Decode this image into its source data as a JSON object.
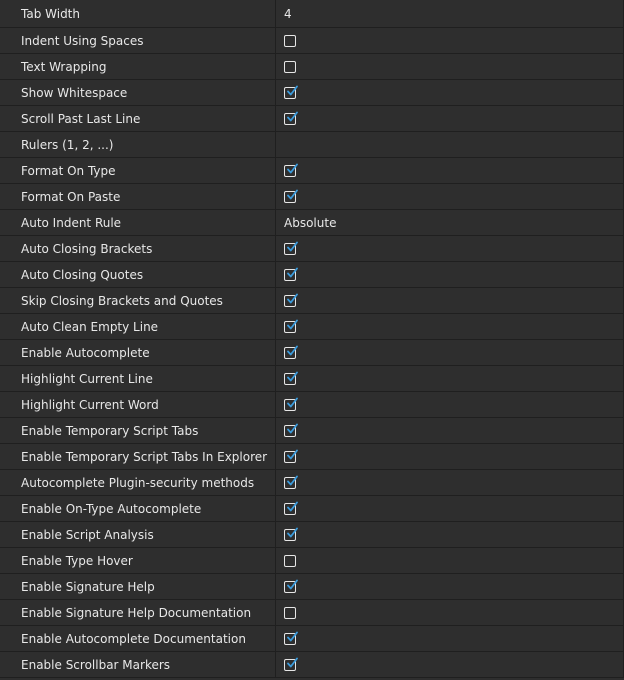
{
  "settings": {
    "rows": [
      {
        "label": "Tab Width",
        "type": "text",
        "value": "4"
      },
      {
        "label": "Indent Using Spaces",
        "type": "checkbox",
        "checked": false
      },
      {
        "label": "Text Wrapping",
        "type": "checkbox",
        "checked": false
      },
      {
        "label": "Show Whitespace",
        "type": "checkbox",
        "checked": true
      },
      {
        "label": "Scroll Past Last Line",
        "type": "checkbox",
        "checked": true
      },
      {
        "label": "Rulers (1, 2, ...)",
        "type": "text",
        "value": ""
      },
      {
        "label": "Format On Type",
        "type": "checkbox",
        "checked": true
      },
      {
        "label": "Format On Paste",
        "type": "checkbox",
        "checked": true
      },
      {
        "label": "Auto Indent Rule",
        "type": "text",
        "value": "Absolute"
      },
      {
        "label": "Auto Closing Brackets",
        "type": "checkbox",
        "checked": true
      },
      {
        "label": "Auto Closing Quotes",
        "type": "checkbox",
        "checked": true
      },
      {
        "label": "Skip Closing Brackets and Quotes",
        "type": "checkbox",
        "checked": true
      },
      {
        "label": "Auto Clean Empty Line",
        "type": "checkbox",
        "checked": true
      },
      {
        "label": "Enable Autocomplete",
        "type": "checkbox",
        "checked": true
      },
      {
        "label": "Highlight Current Line",
        "type": "checkbox",
        "checked": true
      },
      {
        "label": "Highlight Current Word",
        "type": "checkbox",
        "checked": true
      },
      {
        "label": "Enable Temporary Script Tabs",
        "type": "checkbox",
        "checked": true
      },
      {
        "label": "Enable Temporary Script Tabs In Explorer",
        "type": "checkbox",
        "checked": true
      },
      {
        "label": "Autocomplete Plugin-security methods",
        "type": "checkbox",
        "checked": true
      },
      {
        "label": "Enable On-Type Autocomplete",
        "type": "checkbox",
        "checked": true
      },
      {
        "label": "Enable Script Analysis",
        "type": "checkbox",
        "checked": true
      },
      {
        "label": "Enable Type Hover",
        "type": "checkbox",
        "checked": false
      },
      {
        "label": "Enable Signature Help",
        "type": "checkbox",
        "checked": true
      },
      {
        "label": "Enable Signature Help Documentation",
        "type": "checkbox",
        "checked": false
      },
      {
        "label": "Enable Autocomplete Documentation",
        "type": "checkbox",
        "checked": true
      },
      {
        "label": "Enable Scrollbar Markers",
        "type": "checkbox",
        "checked": true
      }
    ]
  },
  "colors": {
    "background": "#2e2e2e",
    "grid_line": "#1f1f1f",
    "text": "#e8e8e8",
    "check_accent": "#3a9bdc"
  },
  "icons": {
    "checked": "checkmark-icon",
    "unchecked": "empty-checkbox-icon"
  }
}
